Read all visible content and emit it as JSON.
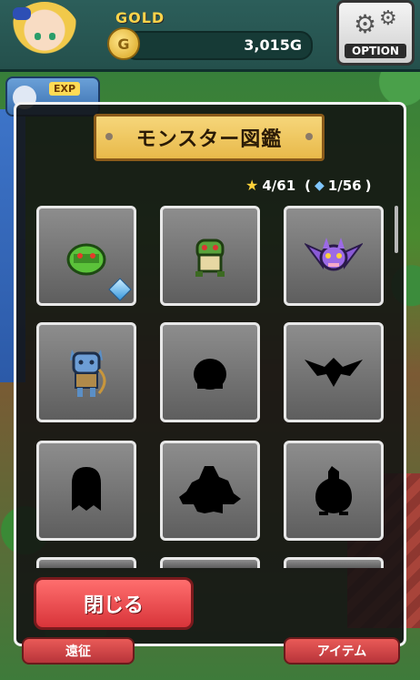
{
  "hud": {
    "gold_label": "GOLD",
    "gold_value": "3,015G",
    "option_label": "OPTION",
    "exp_label": "EXP"
  },
  "modal": {
    "title": "モンスター図鑑",
    "star_count": "4/61",
    "gem_count": "1/56",
    "close_label": "閉じる"
  },
  "cards": [
    {
      "state": "discovered",
      "monster": "green-slime",
      "has_gem": true
    },
    {
      "state": "discovered",
      "monster": "green-lizard",
      "has_gem": false
    },
    {
      "state": "discovered",
      "monster": "purple-bat",
      "has_gem": false
    },
    {
      "state": "discovered",
      "monster": "blue-goblin-archer",
      "has_gem": false
    },
    {
      "state": "silhouette",
      "monster": "round-blob",
      "has_gem": false
    },
    {
      "state": "silhouette",
      "monster": "bird",
      "has_gem": false
    },
    {
      "state": "silhouette",
      "monster": "ghost",
      "has_gem": false
    },
    {
      "state": "silhouette",
      "monster": "large-beast",
      "has_gem": false
    },
    {
      "state": "silhouette",
      "monster": "small-creature",
      "has_gem": false
    }
  ],
  "colors": {
    "modal_border": "#f3f3f3",
    "title_plate": "#f6d67a",
    "close_button": "#e1474b",
    "gold_text": "#ffd44a"
  },
  "background_tabs": {
    "left": "遠征",
    "right": "アイテム"
  }
}
